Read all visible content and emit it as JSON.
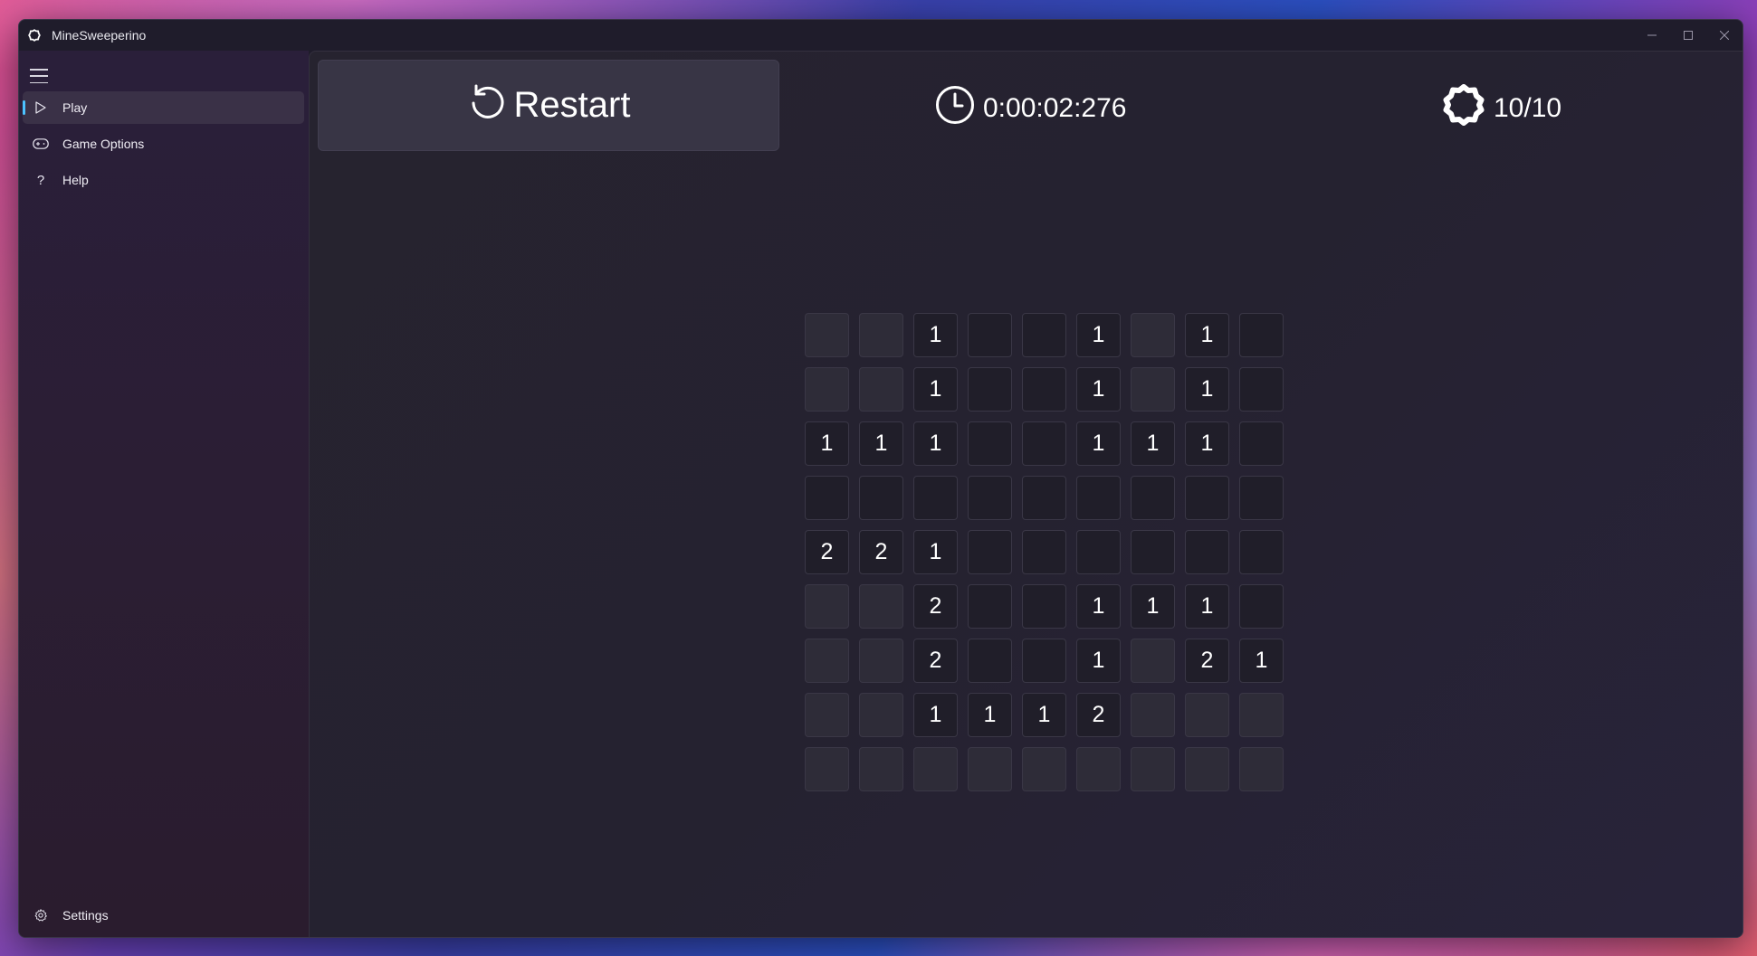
{
  "window": {
    "title": "MineSweeperino",
    "controls": [
      "minimize",
      "maximize",
      "close"
    ]
  },
  "sidebar": {
    "menu_icon": "hamburger-icon",
    "items": [
      {
        "label": "Play",
        "icon": "play-icon",
        "active": true
      },
      {
        "label": "Game Options",
        "icon": "gamepad-icon",
        "active": false
      },
      {
        "label": "Help",
        "icon": "question-icon",
        "active": false
      }
    ],
    "footer": {
      "label": "Settings",
      "icon": "gear-icon"
    }
  },
  "toolbar": {
    "restart_label": "Restart",
    "timer": "0:00:02:276",
    "mines": "10/10"
  },
  "board": {
    "rows": [
      [
        {
          "s": "h",
          "v": ""
        },
        {
          "s": "h",
          "v": ""
        },
        {
          "s": "o",
          "v": "1"
        },
        {
          "s": "o",
          "v": ""
        },
        {
          "s": "o",
          "v": ""
        },
        {
          "s": "o",
          "v": "1"
        },
        {
          "s": "h",
          "v": ""
        },
        {
          "s": "o",
          "v": "1"
        },
        {
          "s": "o",
          "v": ""
        }
      ],
      [
        {
          "s": "h",
          "v": ""
        },
        {
          "s": "h",
          "v": ""
        },
        {
          "s": "o",
          "v": "1"
        },
        {
          "s": "o",
          "v": ""
        },
        {
          "s": "o",
          "v": ""
        },
        {
          "s": "o",
          "v": "1"
        },
        {
          "s": "h",
          "v": ""
        },
        {
          "s": "o",
          "v": "1"
        },
        {
          "s": "o",
          "v": ""
        }
      ],
      [
        {
          "s": "o",
          "v": "1"
        },
        {
          "s": "o",
          "v": "1"
        },
        {
          "s": "o",
          "v": "1"
        },
        {
          "s": "o",
          "v": ""
        },
        {
          "s": "o",
          "v": ""
        },
        {
          "s": "o",
          "v": "1"
        },
        {
          "s": "o",
          "v": "1"
        },
        {
          "s": "o",
          "v": "1"
        },
        {
          "s": "o",
          "v": ""
        }
      ],
      [
        {
          "s": "o",
          "v": ""
        },
        {
          "s": "o",
          "v": ""
        },
        {
          "s": "o",
          "v": ""
        },
        {
          "s": "o",
          "v": ""
        },
        {
          "s": "o",
          "v": ""
        },
        {
          "s": "o",
          "v": ""
        },
        {
          "s": "o",
          "v": ""
        },
        {
          "s": "o",
          "v": ""
        },
        {
          "s": "o",
          "v": ""
        }
      ],
      [
        {
          "s": "o",
          "v": "2"
        },
        {
          "s": "o",
          "v": "2"
        },
        {
          "s": "o",
          "v": "1"
        },
        {
          "s": "o",
          "v": ""
        },
        {
          "s": "o",
          "v": ""
        },
        {
          "s": "o",
          "v": ""
        },
        {
          "s": "o",
          "v": ""
        },
        {
          "s": "o",
          "v": ""
        },
        {
          "s": "o",
          "v": ""
        }
      ],
      [
        {
          "s": "h",
          "v": ""
        },
        {
          "s": "h",
          "v": ""
        },
        {
          "s": "o",
          "v": "2"
        },
        {
          "s": "o",
          "v": ""
        },
        {
          "s": "o",
          "v": ""
        },
        {
          "s": "o",
          "v": "1"
        },
        {
          "s": "o",
          "v": "1"
        },
        {
          "s": "o",
          "v": "1"
        },
        {
          "s": "o",
          "v": ""
        }
      ],
      [
        {
          "s": "h",
          "v": ""
        },
        {
          "s": "h",
          "v": ""
        },
        {
          "s": "o",
          "v": "2"
        },
        {
          "s": "o",
          "v": ""
        },
        {
          "s": "o",
          "v": ""
        },
        {
          "s": "o",
          "v": "1"
        },
        {
          "s": "h",
          "v": ""
        },
        {
          "s": "o",
          "v": "2"
        },
        {
          "s": "o",
          "v": "1"
        }
      ],
      [
        {
          "s": "h",
          "v": ""
        },
        {
          "s": "h",
          "v": ""
        },
        {
          "s": "o",
          "v": "1"
        },
        {
          "s": "o",
          "v": "1"
        },
        {
          "s": "o",
          "v": "1"
        },
        {
          "s": "o",
          "v": "2"
        },
        {
          "s": "h",
          "v": ""
        },
        {
          "s": "h",
          "v": ""
        },
        {
          "s": "h",
          "v": ""
        }
      ],
      [
        {
          "s": "h",
          "v": ""
        },
        {
          "s": "h",
          "v": ""
        },
        {
          "s": "h",
          "v": ""
        },
        {
          "s": "h",
          "v": ""
        },
        {
          "s": "h",
          "v": ""
        },
        {
          "s": "h",
          "v": ""
        },
        {
          "s": "h",
          "v": ""
        },
        {
          "s": "h",
          "v": ""
        },
        {
          "s": "h",
          "v": ""
        }
      ]
    ]
  },
  "colors": {
    "accent": "#4cc2ff",
    "window_bg": "#1f1c2b",
    "sidebar_active": "#3a3147"
  }
}
